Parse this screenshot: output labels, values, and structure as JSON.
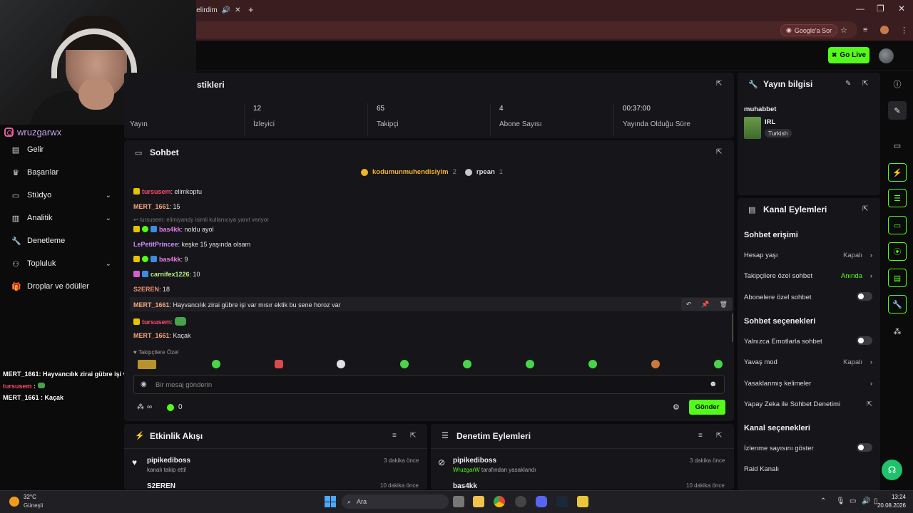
{
  "browser": {
    "tab_title": "Delirdim",
    "google_chip": "Google'a Sor"
  },
  "overlay": {
    "instagram_handle": "wruzgarwx",
    "chat": [
      {
        "user": "MERT_1661",
        "text": ": Hayvancılık zirai gübre işi var mısır ektik bu sene horoz var"
      },
      {
        "user": "tursusem",
        "text": " :"
      },
      {
        "user": "MERT_1661",
        "text": " : Kaçak"
      }
    ]
  },
  "header": {
    "go_live": "Go Live"
  },
  "sidebar": {
    "items": [
      {
        "label": "Gelir",
        "icon": "wallet-icon"
      },
      {
        "label": "Başarılar",
        "icon": "trophy-icon"
      },
      {
        "label": "Stüdyo",
        "icon": "studio-icon",
        "expandable": true
      },
      {
        "label": "Analitik",
        "icon": "analytics-icon",
        "expandable": true
      },
      {
        "label": "Denetleme",
        "icon": "wrench-icon"
      },
      {
        "label": "Topluluk",
        "icon": "community-icon",
        "expandable": true
      },
      {
        "label": "Droplar ve ödüller",
        "icon": "gift-icon"
      }
    ]
  },
  "stats": {
    "title_partial": "stikleri",
    "items": [
      {
        "value": "",
        "label": "Yayın"
      },
      {
        "value": "12",
        "label": "İzleyici"
      },
      {
        "value": "65",
        "label": "Takipçi"
      },
      {
        "value": "4",
        "label": "Abone Sayısı"
      },
      {
        "value": "00:37:00",
        "label": "Yayında Olduğu Süre"
      }
    ]
  },
  "chat": {
    "title": "Sohbet",
    "pinned": [
      {
        "user": "kodumunmuhendisiyim",
        "count": "2"
      },
      {
        "user": "rpean",
        "count": "1"
      }
    ],
    "reply_hint": "tursusem: elimiyandy isimli kullanıcıya yanıt veriyor",
    "messages": [
      {
        "user": "tursusem",
        "color": "red",
        "text": ": elimkoptu"
      },
      {
        "user": "MERT_1661",
        "color": "orange",
        "text": ": 15"
      },
      {
        "user": "bas4kk",
        "color": "pink",
        "text": ": noldu ayol"
      },
      {
        "user": "LePetitPrincee",
        "color": "purple",
        "text": ": keşke 15 yaşında olsam"
      },
      {
        "user": "bas4kk",
        "color": "pink",
        "text": ": 9"
      },
      {
        "user": "carnifex1226",
        "color": "green",
        "text": ": 10"
      },
      {
        "user": "S2EREN",
        "color": "coral",
        "text": ": 18"
      },
      {
        "user": "MERT_1661",
        "color": "orange",
        "text": ": Hayvancılık zirai gübre işi var mısır ektik bu sene horoz var"
      },
      {
        "user": "tursusem",
        "color": "red",
        "text": ":"
      },
      {
        "user": "MERT_1661",
        "color": "orange",
        "text": ": Kaçak"
      }
    ],
    "followers_only_label": "Takipçilere Özel",
    "input_placeholder": "Bir mesaj gönderin",
    "infinite_label": "∞",
    "points": "0",
    "send": "Gönder"
  },
  "activity": {
    "title": "Etkinlik Akışı",
    "items": [
      {
        "user": "pipikediboss",
        "text": "kanalı takip etti!",
        "time": "3 dakika önce"
      },
      {
        "user": "S2EREN",
        "text": "",
        "time": "10 dakika önce"
      }
    ]
  },
  "moderation": {
    "title": "Denetim Eylemleri",
    "items": [
      {
        "user": "pipikediboss",
        "actor": "WruzgarW",
        "text": "tarafından yasaklandı",
        "time": "3 dakika önce"
      },
      {
        "user": "bas4kk",
        "actor": "",
        "text": "",
        "time": "10 dakika önce"
      }
    ]
  },
  "stream_info": {
    "title": "Yayın bilgisi",
    "stream_title": "muhabbet",
    "category": "IRL",
    "language": "Turkish"
  },
  "channel_actions": {
    "title": "Kanal Eylemleri",
    "chat_access": "Sohbet erişimi",
    "account_age": "Hesap yaşı",
    "account_age_value": "Kapalı",
    "followers_chat": "Takipçilere özel sohbet",
    "followers_chat_value": "Anında",
    "subs_chat": "Abonelere özel sohbet",
    "chat_options": "Sohbet seçenekleri",
    "emotes_only": "Yalnızca Emotlarla sohbet",
    "slow_mode": "Yavaş mod",
    "slow_mode_value": "Kapalı",
    "banned_words": "Yasaklanmış kelimeler",
    "ai_moderation": "Yapay Zeka ile Sohbet Denetimi",
    "channel_options": "Kanal seçenekleri",
    "show_viewers": "İzlenme sayısını göster",
    "raid": "Raid Kanalı"
  },
  "taskbar": {
    "weather_temp": "32°C",
    "weather_desc": "Güneşli",
    "search": "Ara",
    "time": "13:24",
    "date": "20.08.2026"
  },
  "colors": {
    "accent": "#53fc18",
    "panel": "#16161a",
    "background": "#0b0b0c"
  }
}
